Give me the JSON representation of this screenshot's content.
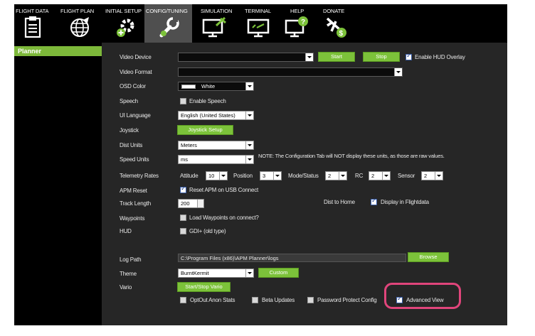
{
  "menu": {
    "tabs": [
      {
        "label": "FLIGHT DATA",
        "icon": "clipboard-icon"
      },
      {
        "label": "FLIGHT PLAN",
        "icon": "globe-icon"
      },
      {
        "label": "INITIAL SETUP",
        "icon": "gear-plus-icon"
      },
      {
        "label": "CONFIG/TUNING",
        "icon": "wrench-icon"
      },
      {
        "label": "SIMULATION",
        "icon": "monitor-plane-icon"
      },
      {
        "label": "TERMINAL",
        "icon": "terminal-icon"
      },
      {
        "label": "HELP",
        "icon": "help-monitor-icon"
      },
      {
        "label": "DONATE",
        "icon": "donate-plane-icon"
      }
    ],
    "active": "CONFIG/TUNING"
  },
  "sidebar": {
    "items": [
      {
        "label": "Planner"
      }
    ]
  },
  "colors": {
    "accent": "#7cc23a",
    "highlight": "#e0457b",
    "panel": "#262626"
  },
  "planner": {
    "video_device": {
      "label": "Video Device",
      "value": "",
      "start_label": "Start",
      "stop_label": "Stop",
      "hud_overlay_label": "Enable HUD Overlay",
      "hud_overlay_checked": true
    },
    "video_format": {
      "label": "Video Format",
      "value": ""
    },
    "osd_color": {
      "label": "OSD Color",
      "value": "White"
    },
    "speech": {
      "label": "Speech",
      "checkbox_label": "Enable Speech",
      "checked": false
    },
    "ui_language": {
      "label": "UI Language",
      "value": "English (United States)"
    },
    "joystick": {
      "label": "Joystick",
      "button_label": "Joystick Setup"
    },
    "dist_units": {
      "label": "Dist Units",
      "value": "Meters"
    },
    "speed_units": {
      "label": "Speed Units",
      "value": "ms"
    },
    "units_note": "NOTE: The Configuration Tab will NOT display these units, as those are raw values.",
    "telemetry": {
      "label": "Telemetry Rates",
      "attitude_label": "Attitude",
      "attitude_value": "10",
      "position_label": "Position",
      "position_value": "3",
      "mode_label": "Mode/Status",
      "mode_value": "2",
      "rc_label": "RC",
      "rc_value": "2",
      "sensor_label": "Sensor",
      "sensor_value": "2"
    },
    "apm_reset": {
      "label": "APM Reset",
      "checkbox_label": "Reset APM on USB Connect",
      "checked": true
    },
    "track_length": {
      "label": "Track Length",
      "value": "200"
    },
    "dist_to_home": {
      "label": "Dist to Home",
      "checkbox_label": "Display in Flightdata",
      "checked": true
    },
    "waypoints": {
      "label": "Waypoints",
      "checkbox_label": "Load Waypoints on connect?",
      "checked": false
    },
    "hud": {
      "label": "HUD",
      "checkbox_label": "GDI+ (old type)",
      "checked": false
    },
    "log_path": {
      "label": "Log Path",
      "value": "C:\\Program Files (x86)\\APM Planner\\logs",
      "browse_label": "Browse"
    },
    "theme": {
      "label": "Theme",
      "value": "BurntKermit",
      "custom_label": "Custom"
    },
    "vario": {
      "label": "Vario",
      "button_label": "Start/Stop Vario"
    },
    "optout": {
      "label": "OptOut Anon Stats",
      "checked": false
    },
    "beta": {
      "label": "Beta Updates",
      "checked": false
    },
    "password": {
      "label": "Password Protect Config",
      "checked": false
    },
    "advanced": {
      "label": "Advanced View",
      "checked": true
    }
  }
}
